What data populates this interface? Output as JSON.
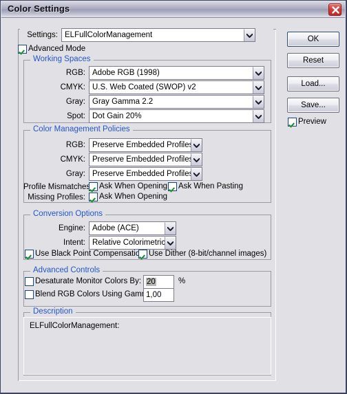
{
  "window": {
    "title": "Color Settings",
    "close_icon": "close-x-icon"
  },
  "settings_row": {
    "label": "Settings:",
    "value": "ELFullColorManagement"
  },
  "advanced_mode": {
    "label": "Advanced Mode",
    "checked": true
  },
  "working_spaces": {
    "title": "Working Spaces",
    "rows": [
      {
        "label": "RGB:",
        "value": "Adobe RGB (1998)"
      },
      {
        "label": "CMYK:",
        "value": "U.S. Web Coated (SWOP) v2"
      },
      {
        "label": "Gray:",
        "value": "Gray Gamma 2.2"
      },
      {
        "label": "Spot:",
        "value": "Dot Gain 20%"
      }
    ]
  },
  "color_management_policies": {
    "title": "Color Management Policies",
    "rows": [
      {
        "label": "RGB:",
        "value": "Preserve Embedded Profiles"
      },
      {
        "label": "CMYK:",
        "value": "Preserve Embedded Profiles"
      },
      {
        "label": "Gray:",
        "value": "Preserve Embedded Profiles"
      }
    ],
    "profile_mismatches_label": "Profile Mismatches:",
    "ask_when_opening_mismatch": "Ask When Opening",
    "ask_when_pasting": "Ask When Pasting",
    "missing_profiles_label": "Missing Profiles:",
    "ask_when_opening_missing": "Ask When Opening"
  },
  "conversion_options": {
    "title": "Conversion Options",
    "engine_label": "Engine:",
    "engine_value": "Adobe (ACE)",
    "intent_label": "Intent:",
    "intent_value": "Relative Colorimetric",
    "black_point_label": "Use Black Point Compensation",
    "dither_label": "Use Dither (8-bit/channel images)"
  },
  "advanced_controls": {
    "title": "Advanced Controls",
    "desaturate_label": "Desaturate Monitor Colors By:",
    "desaturate_value": "20",
    "percent_sign": "%",
    "blend_label": "Blend RGB Colors Using Gamma:",
    "blend_value": "1,00"
  },
  "description": {
    "title": "Description",
    "text": "ELFullColorManagement:"
  },
  "side_buttons": {
    "ok": "OK",
    "reset": "Reset",
    "load": "Load...",
    "save": "Save...",
    "preview_label": "Preview"
  },
  "colors": {
    "group_title": "#2255cc",
    "window_bg": "#e1e1e5",
    "close_red": "#d4403c",
    "check_green": "#178c2e",
    "checkbox_border": "#17467f"
  }
}
